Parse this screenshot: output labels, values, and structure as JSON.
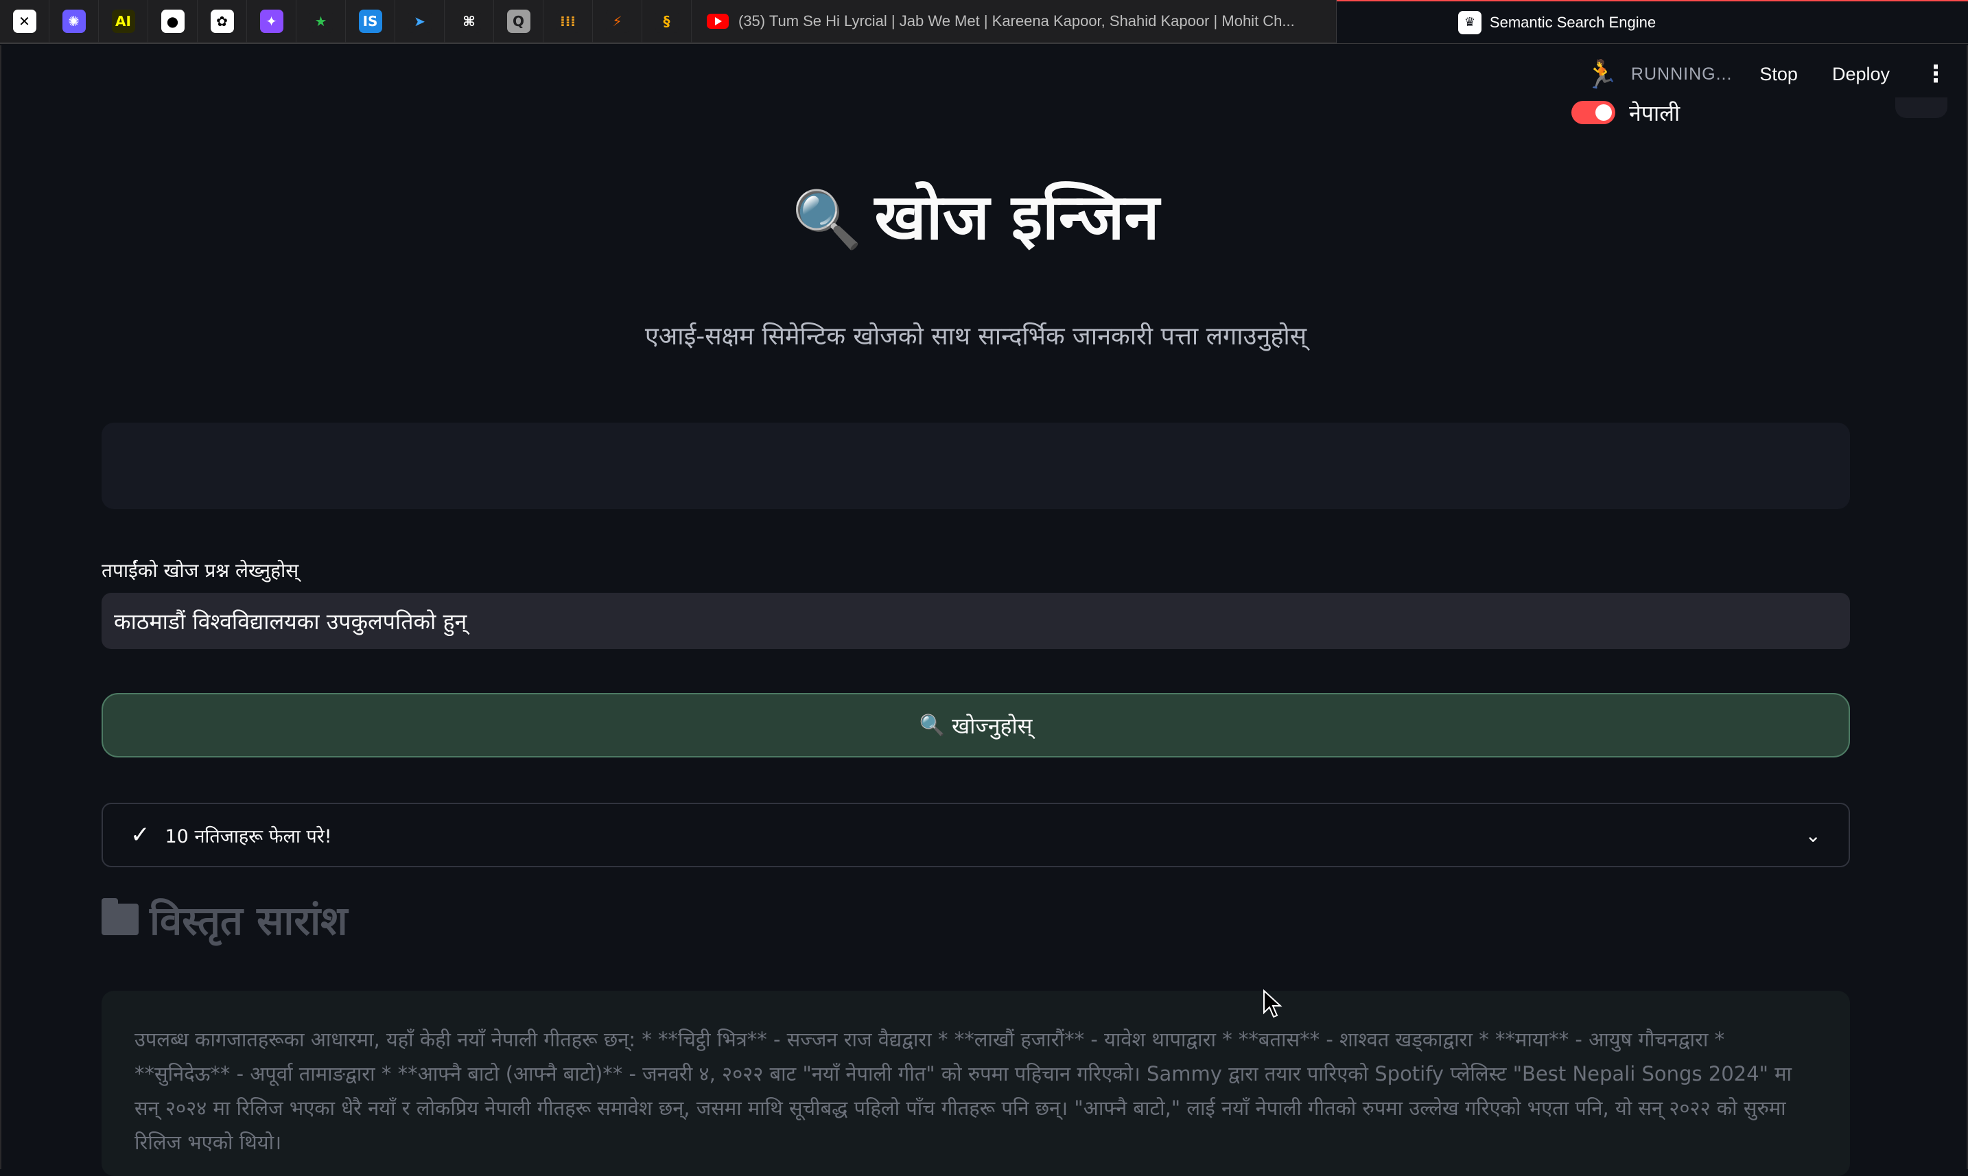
{
  "browser": {
    "pinned_tabs": [
      {
        "name": "x-icon",
        "glyph": "✕",
        "bg": "#ffffff",
        "fg": "#000000"
      },
      {
        "name": "gear-app-icon",
        "glyph": "✺",
        "bg": "#6b5bff",
        "fg": "#ffffff"
      },
      {
        "name": "ai-icon",
        "glyph": "AI",
        "bg": "#2b2b00",
        "fg": "#ffff00"
      },
      {
        "name": "github-icon",
        "glyph": "●",
        "bg": "#ffffff",
        "fg": "#000000"
      },
      {
        "name": "openai-icon",
        "glyph": "✿",
        "bg": "#ffffff",
        "fg": "#000000"
      },
      {
        "name": "perplexity-icon",
        "glyph": "✦",
        "bg": "#8a4dff",
        "fg": "#ffffff"
      },
      {
        "name": "star-icon",
        "glyph": "★",
        "bg": "#1f1f21",
        "fg": "#2fbf4f"
      },
      {
        "name": "is-icon",
        "glyph": "IS",
        "bg": "#1e88e5",
        "fg": "#ffffff"
      },
      {
        "name": "bird-icon",
        "glyph": "➤",
        "bg": "#1f1f21",
        "fg": "#3ea6ff"
      },
      {
        "name": "grid-app-icon",
        "glyph": "⌘",
        "bg": "#1f1f21",
        "fg": "#ffffff"
      },
      {
        "name": "q-icon",
        "glyph": "Q",
        "bg": "#9e9e9e",
        "fg": "#1f1f21"
      },
      {
        "name": "dots-icon",
        "glyph": "⁞⁞⁞",
        "bg": "#1f1f21",
        "fg": "#f0a020"
      },
      {
        "name": "bolt-icon",
        "glyph": "⚡",
        "bg": "#1f1f21",
        "fg": "#ff6a00"
      },
      {
        "name": "swirl-icon",
        "glyph": "§",
        "bg": "#1f1f21",
        "fg": "#ffb300"
      }
    ],
    "tabs": [
      {
        "title": "(35) Tum Se Hi Lyrcial | Jab We Met | Kareena Kapoor, Shahid Kapoor | Mohit Ch..."
      },
      {
        "title": "Semantic Search Engine"
      }
    ]
  },
  "header": {
    "status": "RUNNING...",
    "stop": "Stop",
    "deploy": "Deploy"
  },
  "lang_toggle": {
    "label": "नेपाली",
    "on": true
  },
  "page": {
    "title_icon": "🔍",
    "title": "खोज इन्जिन",
    "subtitle": "एआई-सक्षम सिमेन्टिक खोजको साथ सान्दर्भिक जानकारी पत्ता लगाउनुहोस्",
    "query_label": "तपाईंको खोज प्रश्न लेख्नुहोस्",
    "query_value": "काठमाडौं विश्वविद्यालयका उपकुलपतिको हुन्",
    "search_button_icon": "🔍",
    "search_button": "खोज्नुहोस्",
    "status_text": "10 नतिजाहरू फेला परे!",
    "section_heading": "विस्तृत सारांश",
    "summary": "उपलब्ध कागजातहरूका आधारमा, यहाँ केही नयाँ नेपाली गीतहरू छन्: * **चिट्ठी भित्र** - सज्जन राज वैद्यद्वारा * **लाखौं हजारौं** - यावेश थापाद्वारा * **बतास** - शाश्वत खड्काद्वारा * **माया** - आयुष गौचनद्वारा * **सुनिदेऊ** - अपूर्वा तामाङद्वारा * **आफ्नै बाटो (आफ्नै बाटो)** - जनवरी ४, २०२२ बाट \"नयाँ नेपाली गीत\" को रुपमा पहिचान गरिएको। Sammy द्वारा तयार पारिएको Spotify प्लेलिस्ट \"Best Nepali Songs 2024\" मा सन् २०२४ मा रिलिज भएका धेरै नयाँ र लोकप्रिय नेपाली गीतहरू समावेश छन्, जसमा माथि सूचीबद्ध पहिलो पाँच गीतहरू पनि छन्। \"आफ्नै बाटो,\" लाई नयाँ नेपाली गीतको रुपमा उल्लेख गरिएको भएता पनि, यो सन् २०२२ को सुरुमा रिलिज भएको थियो।"
  },
  "colors": {
    "background": "#0e1117",
    "accent": "#ff4b4b",
    "button_bg": "#2a4237",
    "input_bg": "#262730"
  }
}
